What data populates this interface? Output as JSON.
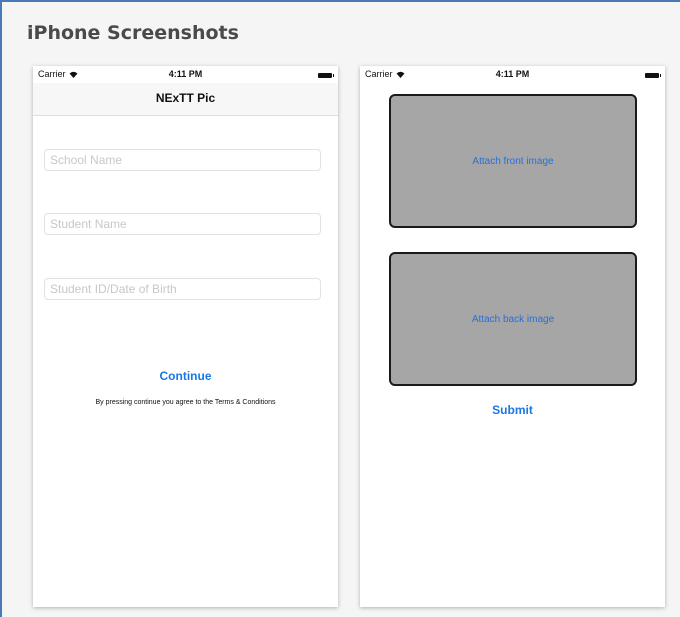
{
  "page": {
    "heading": "iPhone Screenshots"
  },
  "status_bar": {
    "carrier": "Carrier",
    "time": "4:11 PM"
  },
  "screen1": {
    "nav_title": "NExTT Pic",
    "fields": {
      "school_name_placeholder": "School Name",
      "student_name_placeholder": "Student Name",
      "student_id_placeholder": "Student ID/Date of Birth"
    },
    "continue_label": "Continue",
    "terms_text": "By pressing continue you agree to the Terms & Conditions"
  },
  "screen2": {
    "attach_front_label": "Attach front image",
    "attach_back_label": "Attach back image",
    "submit_label": "Submit"
  },
  "colors": {
    "frame_accent": "#4a7ab5",
    "ios_blue": "#1a78e6",
    "attach_box_fill": "#a6a6a6"
  },
  "icons": [
    "wifi-icon",
    "battery-icon"
  ]
}
